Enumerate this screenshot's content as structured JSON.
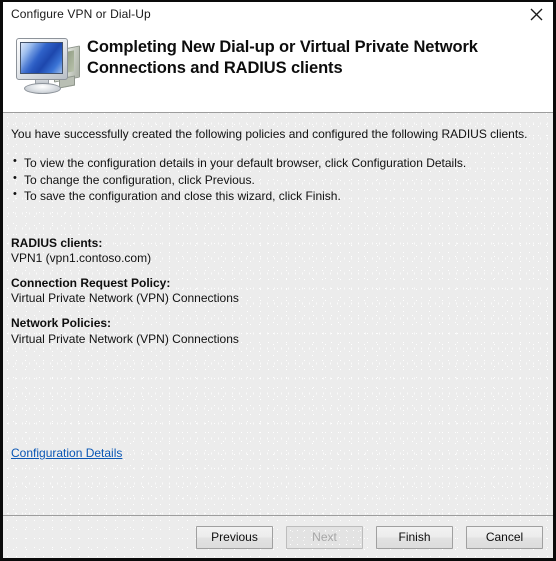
{
  "window": {
    "title": "Configure VPN or Dial-Up",
    "close_icon": "close-icon"
  },
  "header": {
    "icon": "dual-monitor-icon",
    "title": "Completing New Dial-up or Virtual Private Network Connections and RADIUS clients"
  },
  "body": {
    "intro": "You have successfully created the following policies and configured the following RADIUS clients.",
    "bullets": [
      "To view the configuration details in your default browser, click Configuration Details.",
      "To change the configuration, click Previous.",
      "To save the configuration and close this wizard, click Finish."
    ],
    "summary": [
      {
        "label": "RADIUS clients:",
        "value": "VPN1 (vpn1.contoso.com)"
      },
      {
        "label": "Connection Request Policy:",
        "value": "Virtual Private Network (VPN) Connections"
      },
      {
        "label": "Network Policies:",
        "value": "Virtual Private Network (VPN) Connections"
      }
    ],
    "link": "Configuration Details"
  },
  "footer": {
    "buttons": [
      {
        "label": "Previous",
        "disabled": false
      },
      {
        "label": "Next",
        "disabled": true
      },
      {
        "label": "Finish",
        "disabled": false
      },
      {
        "label": "Cancel",
        "disabled": false
      }
    ]
  },
  "colors": {
    "link": "#0b57b5",
    "body_background": "#ececec",
    "screen_blue": "#1d47ad",
    "text": "#111111"
  }
}
